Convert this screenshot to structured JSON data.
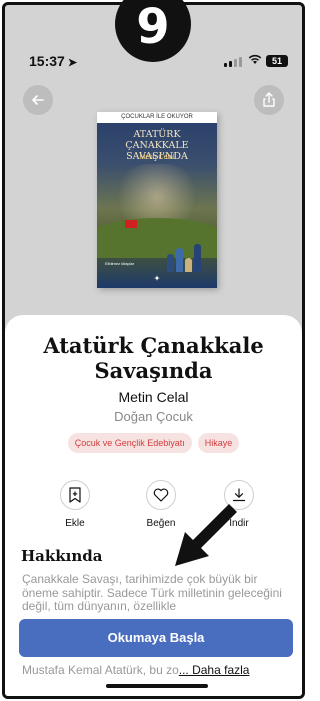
{
  "status": {
    "time": "15:37",
    "battery": "51"
  },
  "step_badge": "9",
  "cover": {
    "top_strip": "ÇOCUKLAR İLE OKUYOR",
    "title_line1": "ATATÜRK",
    "title_line2": "ÇANAKKALE SAVAŞI'NDA",
    "author": "Metin Celal",
    "small": "Elbilmez kitaplar"
  },
  "book": {
    "title": "Atatürk Çanakkale Savaşında",
    "author": "Metin Celal",
    "publisher": "Doğan Çocuk",
    "tags": [
      "Çocuk ve Gençlik Edebiyatı",
      "Hikaye"
    ]
  },
  "actions": {
    "add": "Ekle",
    "like": "Beğen",
    "download": "İndir"
  },
  "about": {
    "heading": "Hakkında",
    "text": "Çanakkale Savaşı, tarihimizde çok büyük bir öneme sahiptir. Sadece Türk milletinin geleceğini değil, tüm dünyanın, özellikle",
    "tail": "Mustafa Kemal Atatürk, bu zo",
    "more": "... Daha fazla"
  },
  "read_button": "Okumaya Başla",
  "colors": {
    "accent": "#4a6ebf",
    "tag_bg": "#f7e2e2",
    "tag_text": "#d23c3c"
  }
}
